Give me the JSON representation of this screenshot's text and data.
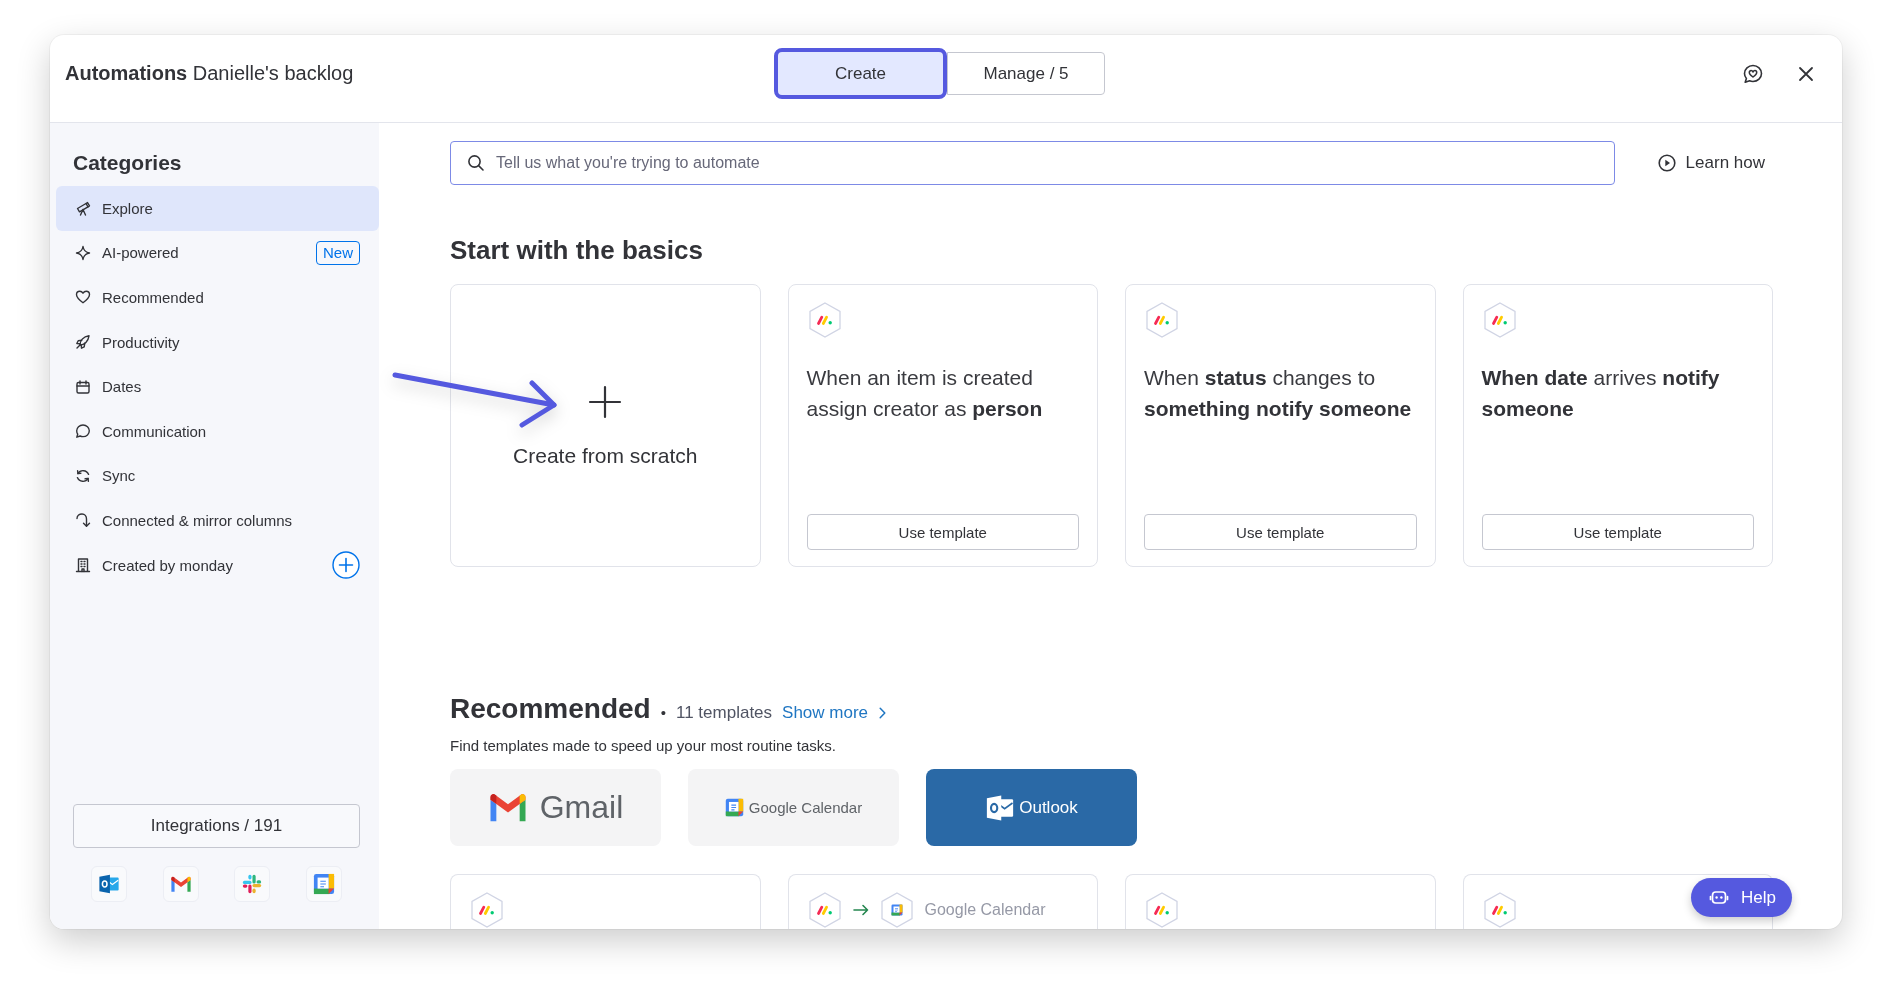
{
  "window": {
    "title": "Automations",
    "board": "Danielle's backlog"
  },
  "tabs": [
    {
      "label": "Create",
      "selected": true
    },
    {
      "label": "Manage / 5",
      "selected": false
    }
  ],
  "sidebar": {
    "title": "Categories",
    "items": [
      {
        "label": "Explore",
        "kind": "plain",
        "selected": true
      },
      {
        "label": "AI-powered",
        "kind": "badge",
        "badge": "New",
        "selected": false
      },
      {
        "label": "Recommended",
        "kind": "plain",
        "selected": false
      },
      {
        "label": "Productivity",
        "kind": "plain",
        "selected": false
      },
      {
        "label": "Dates",
        "kind": "plain",
        "selected": false
      },
      {
        "label": "Communication",
        "kind": "plain",
        "selected": false
      },
      {
        "label": "Sync",
        "kind": "plain",
        "selected": false
      },
      {
        "label": "Connected & mirror columns",
        "kind": "plain",
        "selected": false
      },
      {
        "label": "Created by monday",
        "kind": "add",
        "selected": false
      }
    ],
    "integrations_button": "Integrations / 191"
  },
  "search": {
    "placeholder": "Tell us what you're trying to automate"
  },
  "learn_how": "Learn how",
  "basics": {
    "title": "Start with the basics",
    "cards": [
      {
        "kind": "scratch",
        "text": "Create from scratch"
      },
      {
        "kind": "template",
        "text": "When an item is created assign creator as **person**",
        "button": "Use template"
      },
      {
        "kind": "template",
        "text": "When **status** changes to **something notify someone**",
        "button": "Use template"
      },
      {
        "kind": "template",
        "text": "**When date** arrives **notify someone**",
        "button": "Use template"
      }
    ]
  },
  "recommended": {
    "title": "Recommended",
    "separator": "•",
    "count": "11 templates",
    "link": "Show more",
    "description": "Find templates made to speed up your most routine tasks.",
    "apps": [
      {
        "kind": "gmail",
        "label": "Gmail",
        "selected": false
      },
      {
        "kind": "google_calendar",
        "label": "Google Calendar",
        "selected": false
      },
      {
        "kind": "outlook",
        "label": "Outlook",
        "selected": true
      }
    ],
    "cards": [
      {
        "kind": "single"
      },
      {
        "kind": "integration",
        "app": "Google Calendar"
      },
      {
        "kind": "single"
      },
      {
        "kind": "single"
      }
    ]
  },
  "help": "Help"
}
